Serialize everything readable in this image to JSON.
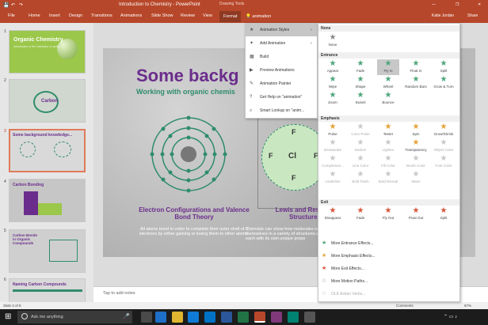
{
  "window": {
    "title": "Introduction to Chemistry - PowerPoint",
    "context_tab": "Drawing Tools",
    "user": "Katie Jordan",
    "controls": [
      "—",
      "❐",
      "✕"
    ]
  },
  "ribbon": {
    "tabs": [
      "File",
      "Home",
      "Insert",
      "Design",
      "Transitions",
      "Animations",
      "Slide Show",
      "Review",
      "View",
      "Format"
    ],
    "search_text": "animation",
    "share": "Share"
  },
  "thumbnails": [
    {
      "num": "1",
      "title": "Organic Chemistry",
      "subtitle": "Introduction to the chemistry of carbon",
      "bg": "#9bc74a"
    },
    {
      "num": "2",
      "title": "Carbon",
      "bg": "#cfd7ce"
    },
    {
      "num": "3",
      "title": "Some background knowledge...",
      "bg": "#d9d9d9"
    },
    {
      "num": "4",
      "title": "Carbon Bonding",
      "bg": "#c6c6c6"
    },
    {
      "num": "5",
      "title": "Carbon Bonds in Organic Compounds",
      "bg": "#cfcfcf"
    },
    {
      "num": "6",
      "title": "Naming Carbon Compounds",
      "bg": "#d9d9d9"
    }
  ],
  "slide": {
    "title": "Some backg",
    "subtitle": "Working with organic chemis",
    "left_heading": "Electron Configurations and Valence Bond Theory",
    "left_body": "All atoms bond in order to complete their outer shell of 8 electrons by either gaining or losing them to other atoms.",
    "right_heading": "Lewis and Resonan Structures",
    "right_body": "Chemists can show how molecules co themselves in a variety of structures a each with its own unique prope",
    "lewis_symbols": [
      "F",
      "Cl",
      "F",
      "F",
      "F"
    ]
  },
  "notes_placeholder": "Tap to add notes",
  "status": {
    "slide": "Slide 3 of 8",
    "zoom": "67%",
    "comments": "Comments"
  },
  "taskbar": {
    "search_placeholder": "Ask me anything"
  },
  "menu1": {
    "items": [
      "Animation Styles",
      "Add Animation",
      "Build",
      "Preview Animations",
      "Animation Painter",
      "Get Help on \"animation\"",
      "Smart Lookup on \"anim..."
    ],
    "icons": [
      "star-icon",
      "add-star-icon",
      "build-icon",
      "preview-icon",
      "painter-icon",
      "help-icon",
      "lookup-icon"
    ]
  },
  "menu2": {
    "none_header": "None",
    "none_label": "None",
    "entrance_header": "Entrance",
    "entrance": [
      "Appear",
      "Fade",
      "Fly In",
      "Float In",
      "Split",
      "Wipe",
      "Shape",
      "Wheel",
      "Random Bars",
      "Grow & Turn",
      "Zoom",
      "Swivel",
      "Bounce"
    ],
    "emphasis_header": "Emphasis",
    "emphasis": [
      "Pulse",
      "Color Pulse",
      "Teeter",
      "Spin",
      "Grow/Shrink",
      "Desaturate",
      "Darken",
      "Lighten",
      "Transparency",
      "Object Color",
      "Complemen...",
      "Line Color",
      "Fill Color",
      "Brush Color",
      "Font Color",
      "Underline",
      "Bold Flash",
      "Bold Reveal",
      "Wave"
    ],
    "emphasis_enabled": [
      true,
      false,
      true,
      true,
      true,
      false,
      false,
      false,
      true,
      false,
      false,
      false,
      false,
      false,
      false,
      false,
      false,
      false,
      false
    ],
    "exit_header": "Exit",
    "exit": [
      "Disappear",
      "Fade",
      "Fly Out",
      "Float Out",
      "Split"
    ],
    "more": [
      "More Entrance Effects...",
      "More Emphasis Effects...",
      "More Exit Effects...",
      "More Motion Paths...",
      "OLE Action Verbs..."
    ],
    "selected": "Fly In",
    "colors": {
      "entrance": "#4ea67a",
      "emphasis": "#e3a43a",
      "exit": "#d9553b",
      "none": "#888888"
    }
  }
}
